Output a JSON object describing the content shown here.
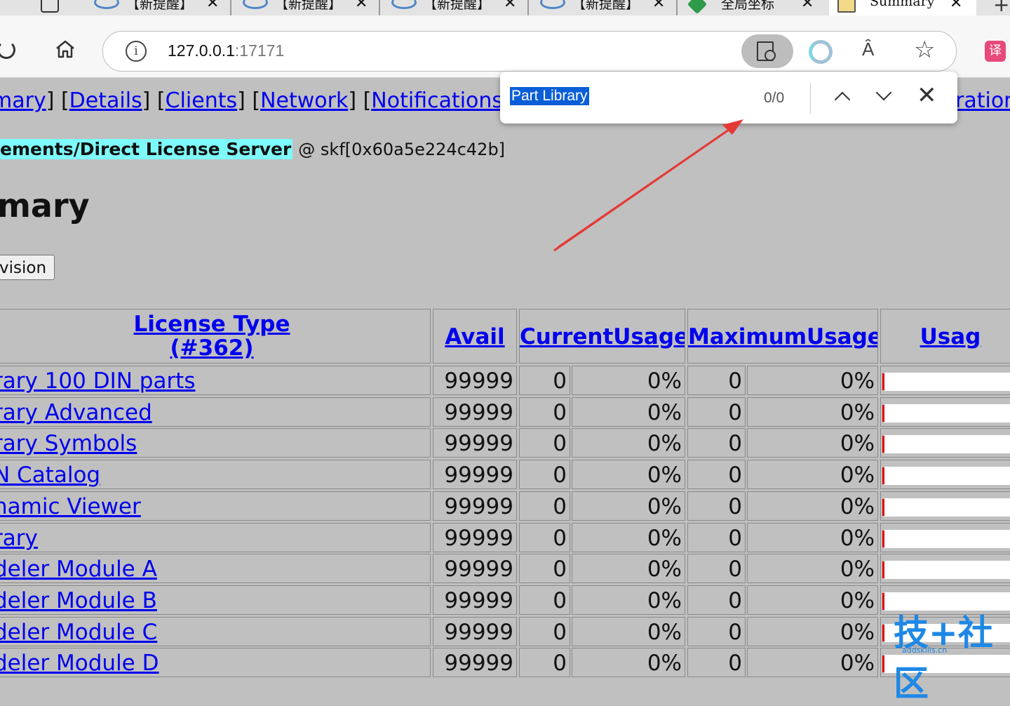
{
  "browser": {
    "tabs": [
      {
        "title": "【新提醒】",
        "favicon": "community-logo-icon"
      },
      {
        "title": "【新提醒】",
        "favicon": "community-logo-icon"
      },
      {
        "title": "【新提醒】",
        "favicon": "community-logo-icon"
      },
      {
        "title": "【新提醒】",
        "favicon": "community-logo-icon"
      },
      {
        "title": "全局坐标",
        "favicon": "green-cube-icon"
      },
      {
        "title": "Summary",
        "favicon": "book-icon",
        "active": true
      }
    ],
    "new_tab": "+",
    "url_host": "127.0.0.1",
    "url_port": ":17171",
    "info_symbol": "i",
    "read_aloud": "Ȃ",
    "translate": "译"
  },
  "find_bar": {
    "query": "Part Library",
    "count": "0/0"
  },
  "page": {
    "nav": {
      "open": "",
      "items": [
        "mary",
        "Details",
        "Clients",
        "Network",
        "Notifications"
      ],
      "tail": "ration"
    },
    "breadcrumb": {
      "highlighted": "ements/Direct License Server",
      "rest": "@ skf[0x60a5e224c42b]"
    },
    "heading": "mary",
    "revision_button": "vision",
    "table": {
      "headers": {
        "license_type": "License Type",
        "license_count": "(#362)",
        "avail": "Avail",
        "current": "CurrentUsage",
        "maximum": "MaximumUsage",
        "usage": "Usag"
      },
      "rows": [
        {
          "name": "rary 100 DIN parts",
          "avail": "99999",
          "cur": "0",
          "cur_pct": "0%",
          "max": "0",
          "max_pct": "0%",
          "usage_fraction": 0
        },
        {
          "name": "rary Advanced",
          "avail": "99999",
          "cur": "0",
          "cur_pct": "0%",
          "max": "0",
          "max_pct": "0%",
          "usage_fraction": 0
        },
        {
          "name": "rary Symbols",
          "avail": "99999",
          "cur": "0",
          "cur_pct": "0%",
          "max": "0",
          "max_pct": "0%",
          "usage_fraction": 0
        },
        {
          "name": "N Catalog",
          "avail": "99999",
          "cur": "0",
          "cur_pct": "0%",
          "max": "0",
          "max_pct": "0%",
          "usage_fraction": 0
        },
        {
          "name": "namic Viewer",
          "avail": "99999",
          "cur": "0",
          "cur_pct": "0%",
          "max": "0",
          "max_pct": "0%",
          "usage_fraction": 0
        },
        {
          "name": "rary",
          "avail": "99999",
          "cur": "0",
          "cur_pct": "0%",
          "max": "0",
          "max_pct": "0%",
          "usage_fraction": 0
        },
        {
          "name": "deler Module A",
          "avail": "99999",
          "cur": "0",
          "cur_pct": "0%",
          "max": "0",
          "max_pct": "0%",
          "usage_fraction": 0
        },
        {
          "name": "deler Module B",
          "avail": "99999",
          "cur": "0",
          "cur_pct": "0%",
          "max": "0",
          "max_pct": "0%",
          "usage_fraction": 0
        },
        {
          "name": "deler Module C",
          "avail": "99999",
          "cur": "0",
          "cur_pct": "0%",
          "max": "0",
          "max_pct": "0%",
          "usage_fraction": 0
        },
        {
          "name": "deler Module D",
          "avail": "99999",
          "cur": "0",
          "cur_pct": "0%",
          "max": "0",
          "max_pct": "0%",
          "usage_fraction": 0
        }
      ]
    }
  },
  "watermark": {
    "logo": "技+社区",
    "site": "addskills.cn"
  },
  "colors": {
    "link": "#0000ee",
    "highlight": "#7ffafa",
    "page_bg": "#c0c0c0",
    "annotation_arrow": "#e53935",
    "usage_bar": "#e00000"
  }
}
